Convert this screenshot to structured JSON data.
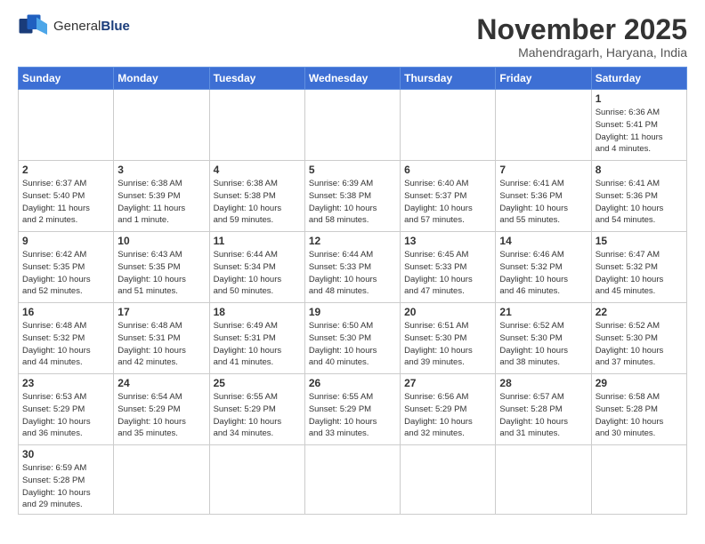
{
  "logo": {
    "text_general": "General",
    "text_blue": "Blue"
  },
  "title": "November 2025",
  "location": "Mahendragarh, Haryana, India",
  "header": {
    "days": [
      "Sunday",
      "Monday",
      "Tuesday",
      "Wednesday",
      "Thursday",
      "Friday",
      "Saturday"
    ]
  },
  "weeks": [
    [
      {
        "day": "",
        "info": ""
      },
      {
        "day": "",
        "info": ""
      },
      {
        "day": "",
        "info": ""
      },
      {
        "day": "",
        "info": ""
      },
      {
        "day": "",
        "info": ""
      },
      {
        "day": "",
        "info": ""
      },
      {
        "day": "1",
        "info": "Sunrise: 6:36 AM\nSunset: 5:41 PM\nDaylight: 11 hours\nand 4 minutes."
      }
    ],
    [
      {
        "day": "2",
        "info": "Sunrise: 6:37 AM\nSunset: 5:40 PM\nDaylight: 11 hours\nand 2 minutes."
      },
      {
        "day": "3",
        "info": "Sunrise: 6:38 AM\nSunset: 5:39 PM\nDaylight: 11 hours\nand 1 minute."
      },
      {
        "day": "4",
        "info": "Sunrise: 6:38 AM\nSunset: 5:38 PM\nDaylight: 10 hours\nand 59 minutes."
      },
      {
        "day": "5",
        "info": "Sunrise: 6:39 AM\nSunset: 5:38 PM\nDaylight: 10 hours\nand 58 minutes."
      },
      {
        "day": "6",
        "info": "Sunrise: 6:40 AM\nSunset: 5:37 PM\nDaylight: 10 hours\nand 57 minutes."
      },
      {
        "day": "7",
        "info": "Sunrise: 6:41 AM\nSunset: 5:36 PM\nDaylight: 10 hours\nand 55 minutes."
      },
      {
        "day": "8",
        "info": "Sunrise: 6:41 AM\nSunset: 5:36 PM\nDaylight: 10 hours\nand 54 minutes."
      }
    ],
    [
      {
        "day": "9",
        "info": "Sunrise: 6:42 AM\nSunset: 5:35 PM\nDaylight: 10 hours\nand 52 minutes."
      },
      {
        "day": "10",
        "info": "Sunrise: 6:43 AM\nSunset: 5:35 PM\nDaylight: 10 hours\nand 51 minutes."
      },
      {
        "day": "11",
        "info": "Sunrise: 6:44 AM\nSunset: 5:34 PM\nDaylight: 10 hours\nand 50 minutes."
      },
      {
        "day": "12",
        "info": "Sunrise: 6:44 AM\nSunset: 5:33 PM\nDaylight: 10 hours\nand 48 minutes."
      },
      {
        "day": "13",
        "info": "Sunrise: 6:45 AM\nSunset: 5:33 PM\nDaylight: 10 hours\nand 47 minutes."
      },
      {
        "day": "14",
        "info": "Sunrise: 6:46 AM\nSunset: 5:32 PM\nDaylight: 10 hours\nand 46 minutes."
      },
      {
        "day": "15",
        "info": "Sunrise: 6:47 AM\nSunset: 5:32 PM\nDaylight: 10 hours\nand 45 minutes."
      }
    ],
    [
      {
        "day": "16",
        "info": "Sunrise: 6:48 AM\nSunset: 5:32 PM\nDaylight: 10 hours\nand 44 minutes."
      },
      {
        "day": "17",
        "info": "Sunrise: 6:48 AM\nSunset: 5:31 PM\nDaylight: 10 hours\nand 42 minutes."
      },
      {
        "day": "18",
        "info": "Sunrise: 6:49 AM\nSunset: 5:31 PM\nDaylight: 10 hours\nand 41 minutes."
      },
      {
        "day": "19",
        "info": "Sunrise: 6:50 AM\nSunset: 5:30 PM\nDaylight: 10 hours\nand 40 minutes."
      },
      {
        "day": "20",
        "info": "Sunrise: 6:51 AM\nSunset: 5:30 PM\nDaylight: 10 hours\nand 39 minutes."
      },
      {
        "day": "21",
        "info": "Sunrise: 6:52 AM\nSunset: 5:30 PM\nDaylight: 10 hours\nand 38 minutes."
      },
      {
        "day": "22",
        "info": "Sunrise: 6:52 AM\nSunset: 5:30 PM\nDaylight: 10 hours\nand 37 minutes."
      }
    ],
    [
      {
        "day": "23",
        "info": "Sunrise: 6:53 AM\nSunset: 5:29 PM\nDaylight: 10 hours\nand 36 minutes."
      },
      {
        "day": "24",
        "info": "Sunrise: 6:54 AM\nSunset: 5:29 PM\nDaylight: 10 hours\nand 35 minutes."
      },
      {
        "day": "25",
        "info": "Sunrise: 6:55 AM\nSunset: 5:29 PM\nDaylight: 10 hours\nand 34 minutes."
      },
      {
        "day": "26",
        "info": "Sunrise: 6:55 AM\nSunset: 5:29 PM\nDaylight: 10 hours\nand 33 minutes."
      },
      {
        "day": "27",
        "info": "Sunrise: 6:56 AM\nSunset: 5:29 PM\nDaylight: 10 hours\nand 32 minutes."
      },
      {
        "day": "28",
        "info": "Sunrise: 6:57 AM\nSunset: 5:28 PM\nDaylight: 10 hours\nand 31 minutes."
      },
      {
        "day": "29",
        "info": "Sunrise: 6:58 AM\nSunset: 5:28 PM\nDaylight: 10 hours\nand 30 minutes."
      }
    ],
    [
      {
        "day": "30",
        "info": "Sunrise: 6:59 AM\nSunset: 5:28 PM\nDaylight: 10 hours\nand 29 minutes."
      },
      {
        "day": "",
        "info": ""
      },
      {
        "day": "",
        "info": ""
      },
      {
        "day": "",
        "info": ""
      },
      {
        "day": "",
        "info": ""
      },
      {
        "day": "",
        "info": ""
      },
      {
        "day": "",
        "info": ""
      }
    ]
  ]
}
